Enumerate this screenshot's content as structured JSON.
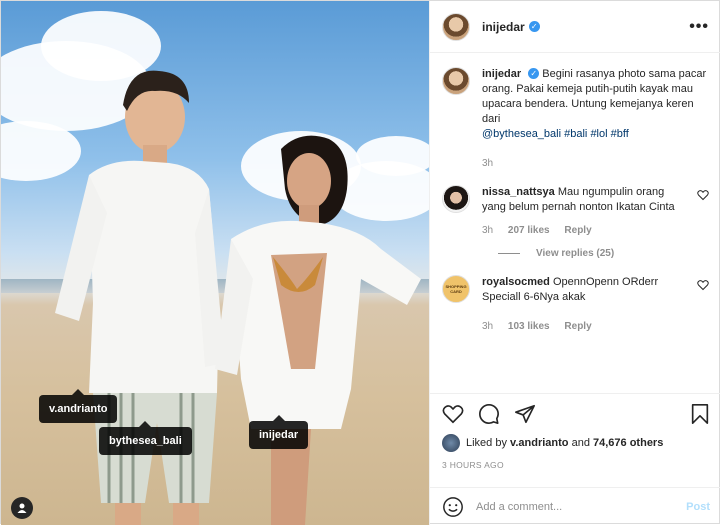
{
  "post": {
    "username": "inijedar",
    "verified": true
  },
  "photo_tags": [
    {
      "label": "v.andrianto"
    },
    {
      "label": "bythesea_bali"
    },
    {
      "label": "inijedar"
    }
  ],
  "caption": {
    "username": "inijedar",
    "text": "Begini rasanya photo sama pacar orang. Pakai kemeja putih-putih kayak mau upacara bendera. Untung kemejanya keren dari",
    "mention": "@bythesea_bali",
    "hashtags": [
      "#bali",
      "#lol",
      "#bff"
    ],
    "time": "3h"
  },
  "comments": [
    {
      "username": "nissa_nattsya",
      "text": "Mau ngumpulin orang yang belum pernah nonton Ikatan Cinta",
      "time": "3h",
      "likes": "207 likes",
      "reply": "Reply",
      "view_replies": "View replies (25)"
    },
    {
      "username": "royalsocmed",
      "text": "OpennOpenn ORderr Speciall 6-6Nya akak",
      "time": "3h",
      "likes": "103 likes",
      "reply": "Reply",
      "avatar_text": "SHOPPING CARD"
    }
  ],
  "likes": {
    "prefix": "Liked by",
    "user": "v.andrianto",
    "joiner": "and",
    "others": "74,676 others"
  },
  "timestamp": "3 HOURS AGO",
  "add_comment": {
    "placeholder": "Add a comment...",
    "post_label": "Post"
  },
  "colors": {
    "verified": "#3897f0",
    "link": "#00376b",
    "post_disabled": "#b2dffc"
  },
  "icons": [
    "more-icon",
    "heart-icon",
    "comment-icon",
    "share-icon",
    "bookmark-icon",
    "emoji-icon",
    "user-tag-icon"
  ]
}
